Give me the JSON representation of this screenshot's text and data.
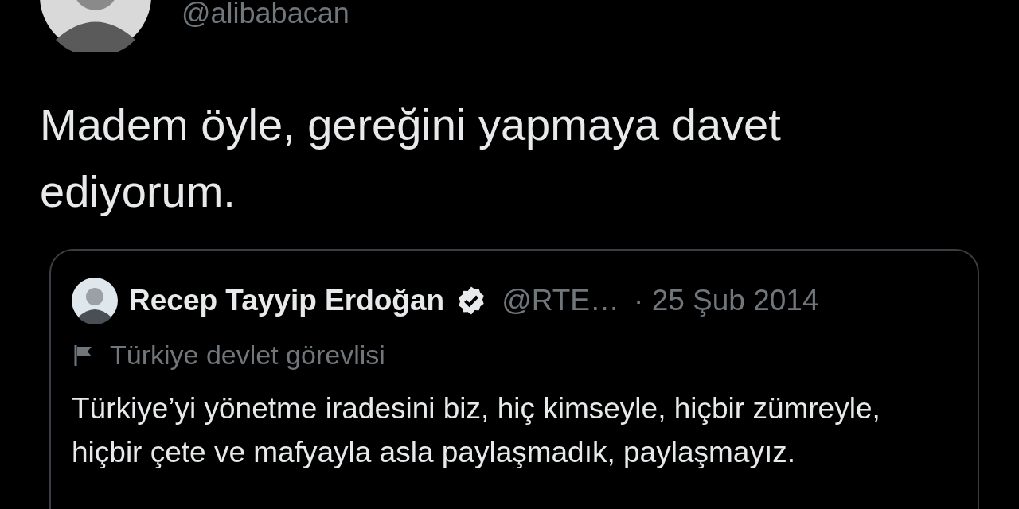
{
  "author": {
    "handle": "@alibabacan"
  },
  "tweet_text": "Madem öyle, gereğini yapmaya davet ediyorum.",
  "quoted_tweet": {
    "name": "Recep Tayyip Erdoğan",
    "verified": true,
    "handle": "@RTE…",
    "date": "· 25 Şub 2014",
    "label": "Türkiye devlet görevlisi",
    "text": "Türkiye’yi yönetme iradesini biz, hiç kimseyle, hiçbir zümreyle, hiçbir çete ve mafyayla asla paylaşmadık, paylaşmayız."
  }
}
